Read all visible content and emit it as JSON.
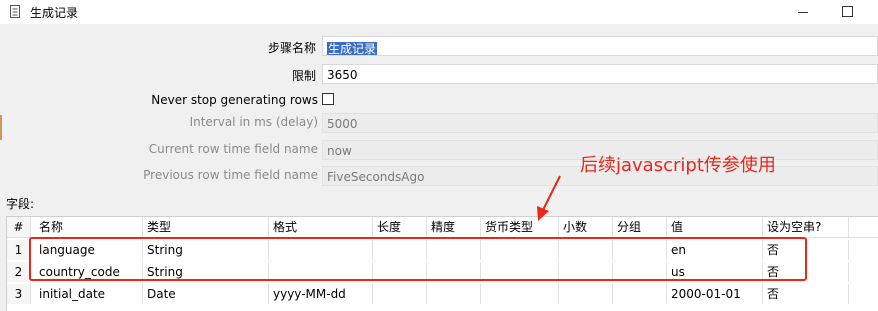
{
  "window": {
    "title": "生成记录"
  },
  "form": {
    "step_name_label": "步骤名称",
    "step_name_value": "生成记录",
    "limit_label": "限制",
    "limit_value": "3650",
    "never_stop_label": "Never stop generating rows",
    "never_stop_checked": false,
    "interval_label": "Interval in ms (delay)",
    "interval_value": "5000",
    "current_row_label": "Current row time field name",
    "current_row_value": "now",
    "previous_row_label": "Previous row time field name",
    "previous_row_value": "FiveSecondsAgo"
  },
  "annotation": {
    "text": "后续javascript传参使用",
    "color": "#e8281b"
  },
  "fields": {
    "label": "字段:",
    "columns": [
      "#",
      "名称",
      "类型",
      "格式",
      "长度",
      "精度",
      "货币类型",
      "小数",
      "分组",
      "值",
      "设为空串?"
    ],
    "rows": [
      {
        "num": "1",
        "name": "language",
        "type": "String",
        "format": "",
        "length": "",
        "precision": "",
        "currency": "",
        "decimal": "",
        "group": "",
        "value": "en",
        "empty": "否"
      },
      {
        "num": "2",
        "name": "country_code",
        "type": "String",
        "format": "",
        "length": "",
        "precision": "",
        "currency": "",
        "decimal": "",
        "group": "",
        "value": "us",
        "empty": "否"
      },
      {
        "num": "3",
        "name": "initial_date",
        "type": "Date",
        "format": "yyyy-MM-dd",
        "length": "",
        "precision": "",
        "currency": "",
        "decimal": "",
        "group": "",
        "value": "2000-01-01",
        "empty": "否"
      }
    ]
  },
  "colors": {
    "selection": "#3b6ec0",
    "annotation": "#e8281b"
  }
}
